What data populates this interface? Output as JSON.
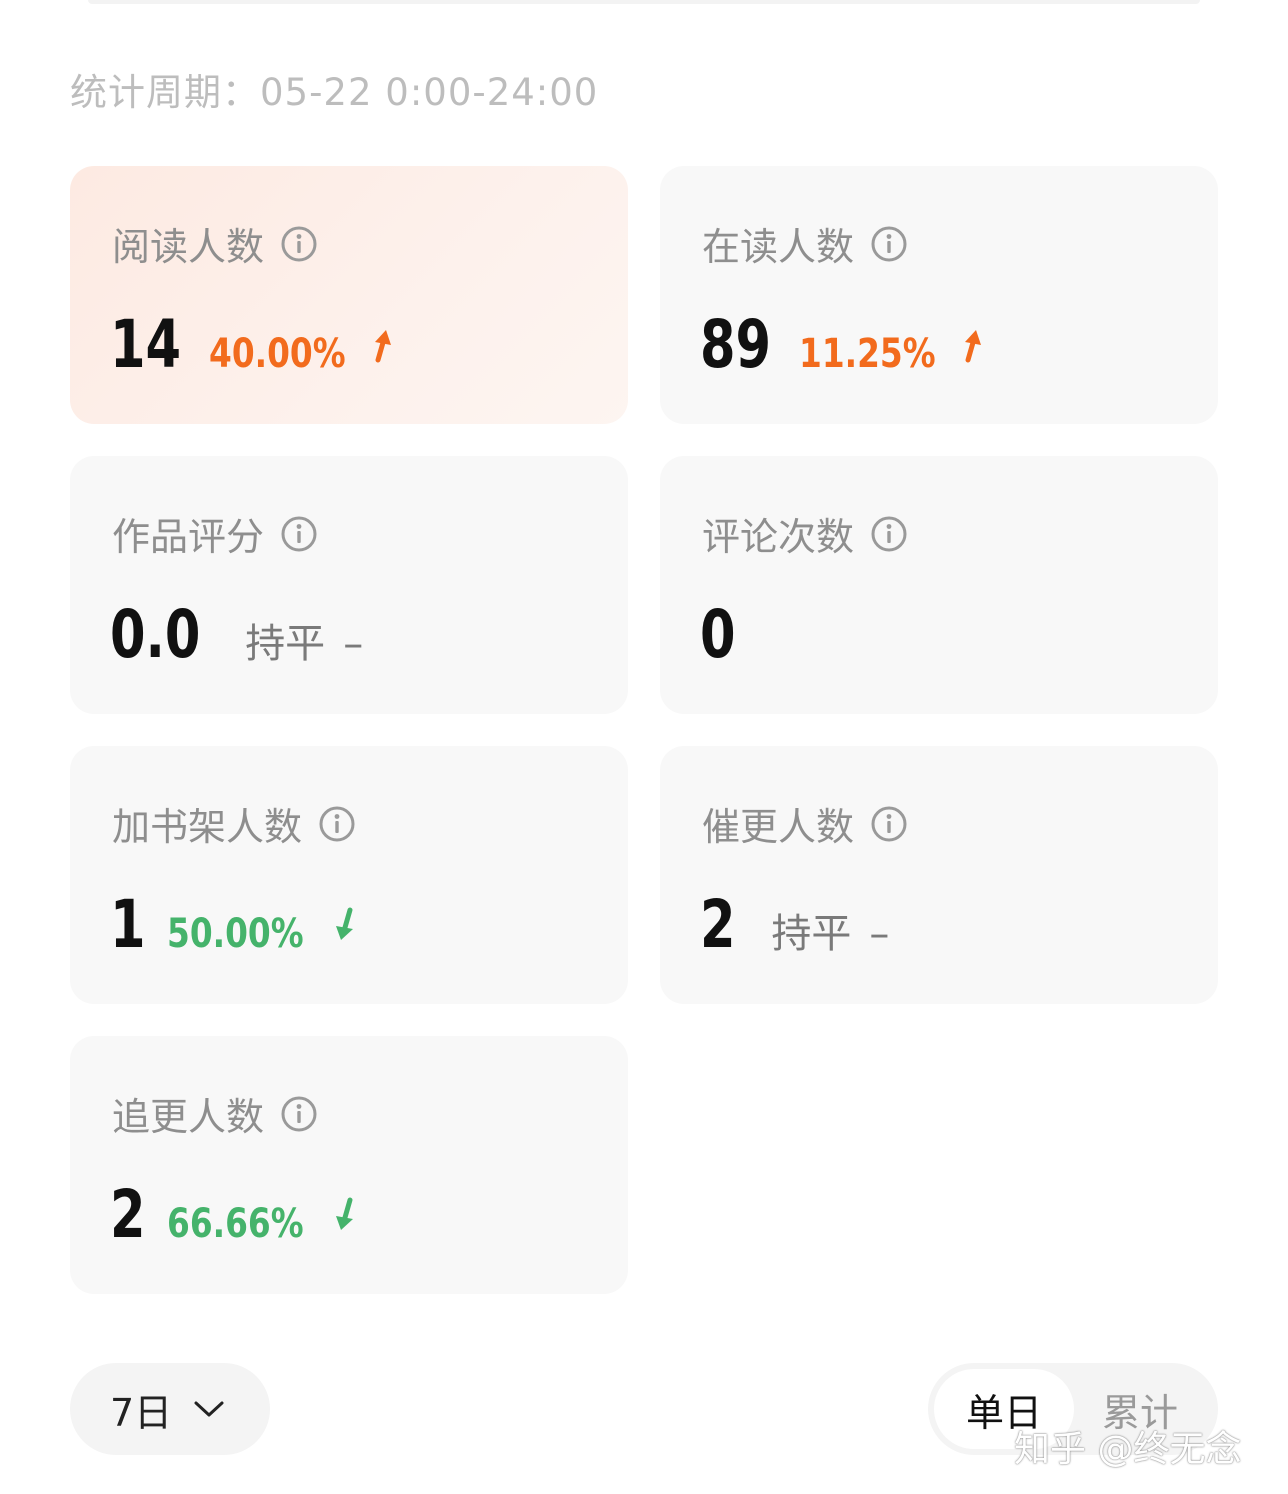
{
  "period": {
    "text": "统计周期：05-22 0:00-24:00"
  },
  "cards": [
    {
      "title": "阅读人数",
      "value": "14",
      "change": "40.00%",
      "trend": "up"
    },
    {
      "title": "在读人数",
      "value": "89",
      "change": "11.25%",
      "trend": "up"
    },
    {
      "title": "作品评分",
      "value": "0.0",
      "flat_text": "持平",
      "flat_dash": "–"
    },
    {
      "title": "评论次数",
      "value": "0"
    },
    {
      "title": "加书架人数",
      "value": "1",
      "change": "50.00%",
      "trend": "down"
    },
    {
      "title": "催更人数",
      "value": "2",
      "flat_text": "持平",
      "flat_dash": "–"
    },
    {
      "title": "追更人数",
      "value": "2",
      "change": "66.66%",
      "trend": "down"
    }
  ],
  "range_select": {
    "label": "7日"
  },
  "mode_toggle": {
    "active": "单日",
    "inactive": "累计"
  },
  "watermark": {
    "text": "知乎 @终无念"
  },
  "colors": {
    "up": "#f26b1d",
    "down": "#45b36b",
    "card_bg": "#f8f8f8",
    "highlight_bg": "#fdeae2"
  },
  "icons": {
    "info": "info-icon",
    "up_arrow": "arrow-up-icon",
    "down_arrow": "arrow-down-icon",
    "chevron": "chevron-down-icon"
  }
}
